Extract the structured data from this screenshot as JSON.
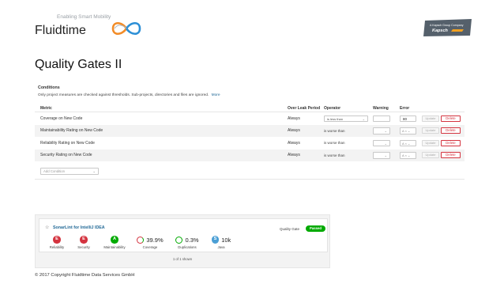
{
  "header": {
    "tagline": "Enabling Smart Mobility",
    "brand": "Fluidtime",
    "badge_line1": "A Kapsch Group Company",
    "badge_brand": "Kapsch",
    "colors": {
      "badge_bg": "#55606b",
      "logo_orange": "#f28c28",
      "logo_blue": "#2c8fd6",
      "logo_gray": "#b0b6bc"
    }
  },
  "slide_title": "Quality Gates II",
  "conditions": {
    "title": "Conditions",
    "note": "Only project measures are checked against thresholds. Sub-projects, directories and files are ignored.",
    "more_link": "More",
    "headers": {
      "metric": "Metric",
      "period": "Over Leak Period",
      "operator": "Operator",
      "warning": "Warning",
      "error": "Error"
    },
    "rows": [
      {
        "metric": "Coverage on New Code",
        "period": "Always",
        "operator": "is less than",
        "operator_kind": "select",
        "warning": "",
        "error": "80",
        "error_kind": "input"
      },
      {
        "metric": "Maintainability Rating on New Code",
        "period": "Always",
        "operator": "is worse than",
        "operator_kind": "text",
        "warning": "",
        "error": "A",
        "error_kind": "select"
      },
      {
        "metric": "Reliability Rating on New Code",
        "period": "Always",
        "operator": "is worse than",
        "operator_kind": "text",
        "warning": "",
        "error": "A",
        "error_kind": "select"
      },
      {
        "metric": "Security Rating on New Code",
        "period": "Always",
        "operator": "is worse than",
        "operator_kind": "text",
        "warning": "",
        "error": "A",
        "error_kind": "select"
      }
    ],
    "update_label": "Update",
    "delete_label": "Delete",
    "add_condition_placeholder": "Add Condition",
    "colors": {
      "delete": "#d4333f",
      "link": "#236a97"
    }
  },
  "project": {
    "name": "SonarLint for IntelliJ IDEA",
    "quality_gate_label": "Quality Gate",
    "quality_gate_status": "Passed",
    "measures": [
      {
        "kind": "rating",
        "value": "E",
        "label": "Reliability",
        "color": "#d4333f"
      },
      {
        "kind": "rating",
        "value": "E",
        "label": "Security",
        "color": "#d4333f"
      },
      {
        "kind": "rating",
        "value": "A",
        "label": "Maintainability",
        "color": "#00aa00"
      },
      {
        "kind": "ring",
        "value": "39.9%",
        "label": "Coverage",
        "icon": "coverage-donut-icon"
      },
      {
        "kind": "ring",
        "value": "0.3%",
        "label": "Duplications",
        "icon": "duplications-donut-icon"
      },
      {
        "kind": "size",
        "value": "10k",
        "icon_letter": "S",
        "label": "Java"
      }
    ],
    "footer": "1 of 1 shown",
    "colors": {
      "passed": "#00aa00",
      "size": "#4b9fd5"
    }
  },
  "copyright": "© 2017 Copyright Fluidtime Data Services GmbH"
}
